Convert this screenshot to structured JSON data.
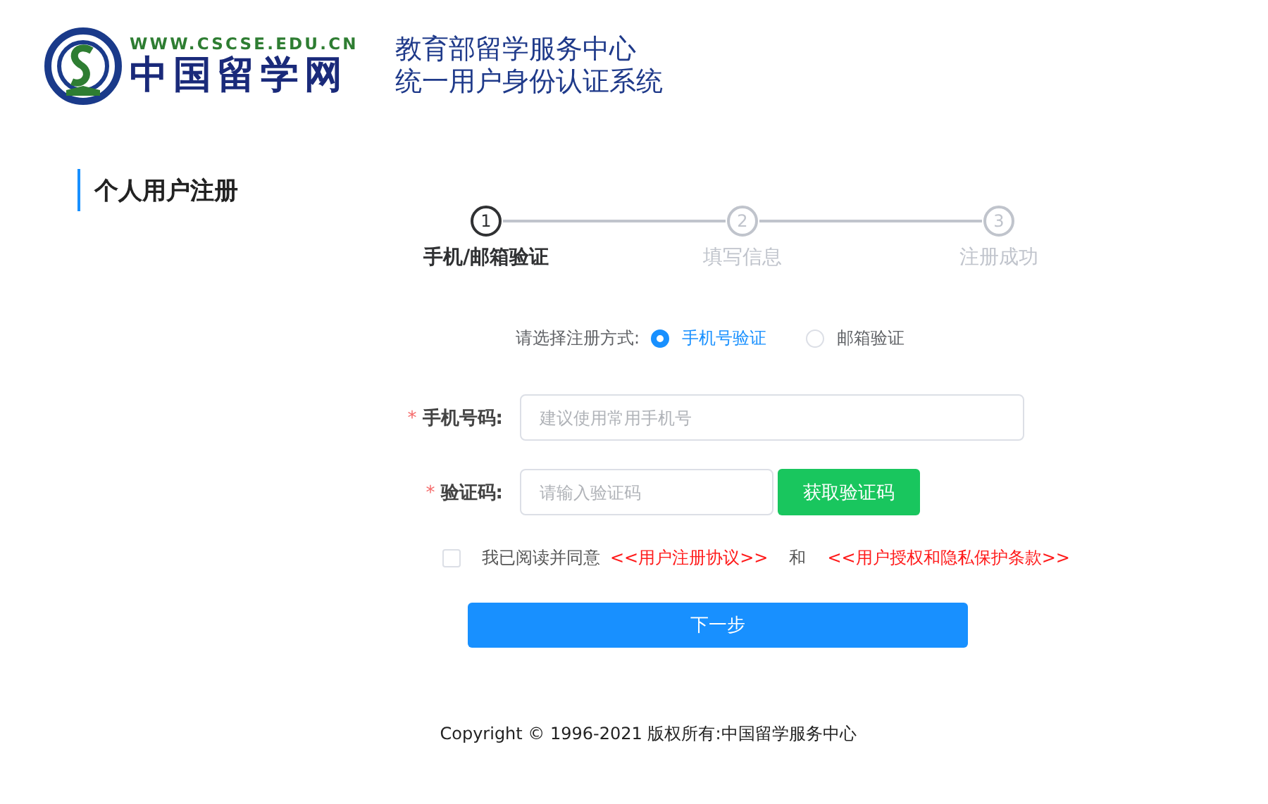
{
  "header": {
    "site_url": "WWW.CSCSE.EDU.CN",
    "site_name": "中国留学网",
    "title_lines": [
      "教育部留学服务中心",
      "统一用户身份认证系统"
    ]
  },
  "section_title": "个人用户注册",
  "steps": [
    {
      "number": "1",
      "label": "手机/邮箱验证",
      "selected": true
    },
    {
      "number": "2",
      "label": "填写信息",
      "selected": false
    },
    {
      "number": "3",
      "label": "注册成功",
      "selected": false
    }
  ],
  "method": {
    "label": "请选择注册方式:",
    "options": [
      {
        "label": "手机号验证",
        "selected": true
      },
      {
        "label": "邮箱验证",
        "selected": false
      }
    ]
  },
  "fields": [
    {
      "required_mark": "*",
      "label": "手机号码:",
      "placeholder": "建议使用常用手机号",
      "kind": "plain"
    },
    {
      "required_mark": "*",
      "label": "验证码:",
      "placeholder": "请输入验证码",
      "kind": "code",
      "button": "获取验证码"
    }
  ],
  "agreement": {
    "checked": false,
    "text": "我已阅读并同意",
    "links": [
      "<<用户注册协议>>",
      "<<用户授权和隐私保护条款>>"
    ],
    "joiner": "和"
  },
  "next_button": "下一步",
  "footer": "Copyright © 1996-2021 版权所有:中国留学服务中心"
}
